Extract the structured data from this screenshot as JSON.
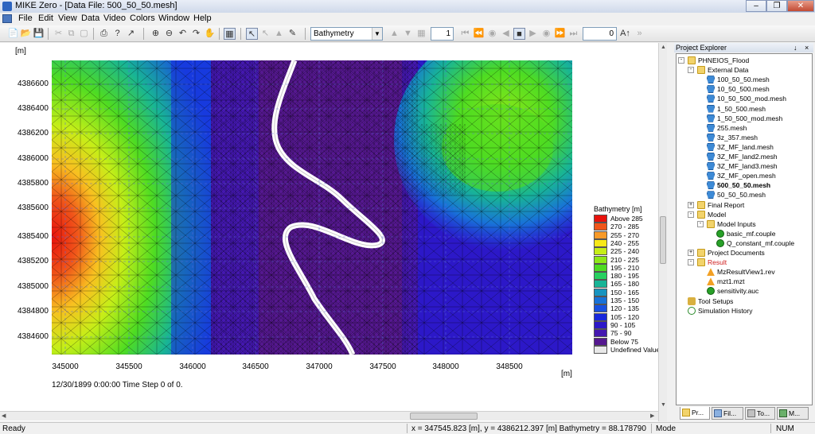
{
  "window": {
    "title": "MIKE Zero - [Data File: 500_50_50.mesh]"
  },
  "menu": [
    "File",
    "Edit",
    "View",
    "Data",
    "Video",
    "Colors",
    "Window",
    "Help"
  ],
  "toolbar": {
    "item_combo": "Bathymetry",
    "time_step": "1",
    "frame": "0"
  },
  "plot": {
    "y_unit": "[m]",
    "x_unit": "[m]",
    "y_ticks": [
      "4386600",
      "4386400",
      "4386200",
      "4386000",
      "4385800",
      "4385600",
      "4385400",
      "4385200",
      "4385000",
      "4384800",
      "4384600"
    ],
    "x_ticks": [
      "345000",
      "345500",
      "346000",
      "346500",
      "347000",
      "347500",
      "348000",
      "348500"
    ],
    "timeline": "12/30/1899 0:00:00  Time Step 0 of 0."
  },
  "legend": {
    "title": "Bathymetry [m]",
    "items": [
      {
        "label": "Above 285",
        "color": "#e8120c"
      },
      {
        "label": "270 - 285",
        "color": "#f0561a"
      },
      {
        "label": "255 - 270",
        "color": "#f89a28"
      },
      {
        "label": "240 - 255",
        "color": "#f8e818"
      },
      {
        "label": "225 - 240",
        "color": "#c6ee18"
      },
      {
        "label": "210 - 225",
        "color": "#8ee818"
      },
      {
        "label": "195 - 210",
        "color": "#4edc22"
      },
      {
        "label": "180 - 195",
        "color": "#28d060"
      },
      {
        "label": "165 - 180",
        "color": "#18b496"
      },
      {
        "label": "150 - 165",
        "color": "#1894c0"
      },
      {
        "label": "135 - 150",
        "color": "#1872d8"
      },
      {
        "label": "120 - 135",
        "color": "#1850e0"
      },
      {
        "label": "105 - 120",
        "color": "#1828dc"
      },
      {
        "label": "90 - 105",
        "color": "#2c18c8"
      },
      {
        "label": "75 -  90",
        "color": "#4418b0"
      },
      {
        "label": "Below  75",
        "color": "#551890"
      },
      {
        "label": "Undefined Value",
        "color": "#e8e8e8"
      }
    ]
  },
  "explorer": {
    "title": "Project Explorer",
    "nodes": [
      {
        "label": "PHNEIOS_Flood",
        "icon": "folder-icon"
      },
      {
        "label": "External Data",
        "icon": "folder-icon"
      },
      {
        "label": "100_50_50.mesh",
        "icon": "mesh-icon"
      },
      {
        "label": "10_50_500.mesh",
        "icon": "mesh-icon"
      },
      {
        "label": "10_50_500_mod.mesh",
        "icon": "mesh-icon"
      },
      {
        "label": "1_50_500.mesh",
        "icon": "mesh-icon"
      },
      {
        "label": "1_50_500_mod.mesh",
        "icon": "mesh-icon"
      },
      {
        "label": "255.mesh",
        "icon": "mesh-icon"
      },
      {
        "label": "3z_357.mesh",
        "icon": "mesh-icon"
      },
      {
        "label": "3Z_MF_land.mesh",
        "icon": "mesh-icon"
      },
      {
        "label": "3Z_MF_land2.mesh",
        "icon": "mesh-icon"
      },
      {
        "label": "3Z_MF_land3.mesh",
        "icon": "mesh-icon"
      },
      {
        "label": "3Z_MF_open.mesh",
        "icon": "mesh-icon"
      },
      {
        "label": "500_50_50.mesh",
        "icon": "mesh-icon"
      },
      {
        "label": "50_50_50.mesh",
        "icon": "mesh-icon"
      },
      {
        "label": "Final Report",
        "icon": "folder-icon"
      },
      {
        "label": "Model",
        "icon": "folder-icon"
      },
      {
        "label": "Model Inputs",
        "icon": "folder-icon"
      },
      {
        "label": "basic_mf.couple",
        "icon": "couple-icon"
      },
      {
        "label": "Q_constant_mf.couple",
        "icon": "couple-icon"
      },
      {
        "label": "Project Documents",
        "icon": "folder-icon"
      },
      {
        "label": "Result",
        "icon": "folder-icon"
      },
      {
        "label": "MzResultView1.rev",
        "icon": "result-icon"
      },
      {
        "label": "mzt1.mzt",
        "icon": "mzt-icon"
      },
      {
        "label": "sensitivity.auc",
        "icon": "auc-icon"
      },
      {
        "label": "Tool Setups",
        "icon": "tools-icon"
      },
      {
        "label": "Simulation History",
        "icon": "history-icon"
      }
    ],
    "tabs": [
      "Pr...",
      "Fil...",
      "To...",
      "M..."
    ]
  },
  "status": {
    "left": "Ready",
    "coords": "x = 347545.823 [m], y = 4386212.397 [m] Bathymetry = 88.178790",
    "mode": "Mode",
    "num": "NUM"
  }
}
